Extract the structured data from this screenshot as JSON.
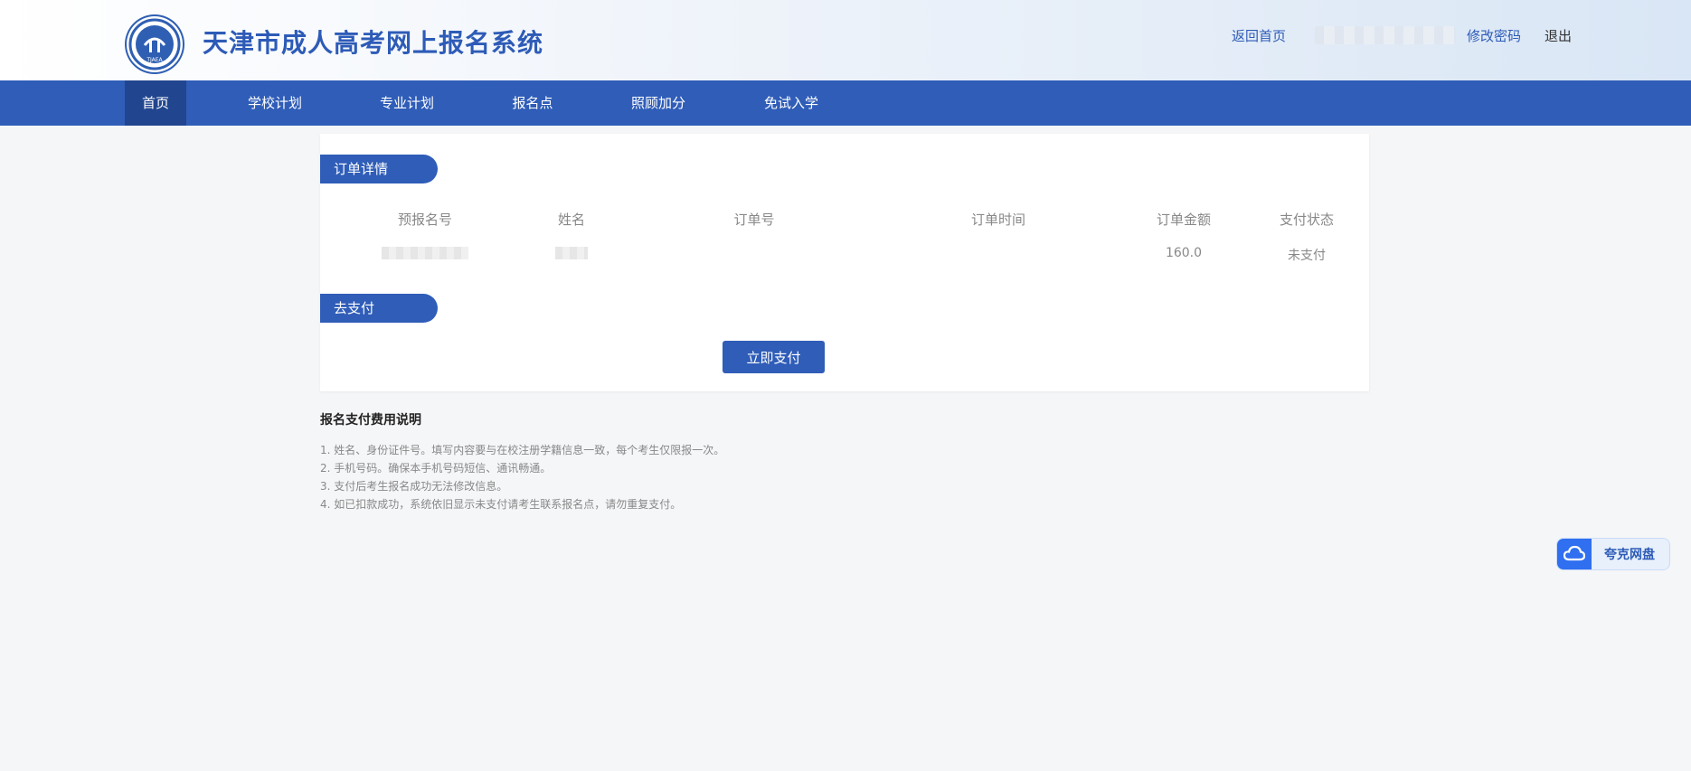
{
  "header": {
    "site_title": "天津市成人高考网上报名系统",
    "logo_text": "TJAEA",
    "links": {
      "home": "返回首页",
      "change_password": "修改密码",
      "logout": "退出"
    }
  },
  "nav": {
    "items": [
      {
        "label": "首页",
        "active": true
      },
      {
        "label": "学校计划",
        "active": false
      },
      {
        "label": "专业计划",
        "active": false
      },
      {
        "label": "报名点",
        "active": false
      },
      {
        "label": "照顾加分",
        "active": false
      },
      {
        "label": "免试入学",
        "active": false
      }
    ]
  },
  "order": {
    "section_title": "订单详情",
    "columns": [
      "预报名号",
      "姓名",
      "订单号",
      "订单时间",
      "订单金额",
      "支付状态"
    ],
    "row": {
      "amount": "160.0",
      "status": "未支付"
    }
  },
  "payment": {
    "section_title": "去支付",
    "pay_button": "立即支付"
  },
  "notes": {
    "title": "报名支付费用说明",
    "lines": [
      "1. 姓名、身份证件号。填写内容要与在校注册学籍信息一致，每个考生仅限报一次。",
      "2. 手机号码。确保本手机号码短信、通讯畅通。",
      "3. 支付后考生报名成功无法修改信息。",
      "4. 如已扣款成功，系统依旧显示未支付请考生联系报名点，请勿重复支付。"
    ]
  },
  "floating": {
    "quark_label": "夸克网盘"
  },
  "colors": {
    "primary": "#2f5db8",
    "nav_active": "#21468f"
  }
}
